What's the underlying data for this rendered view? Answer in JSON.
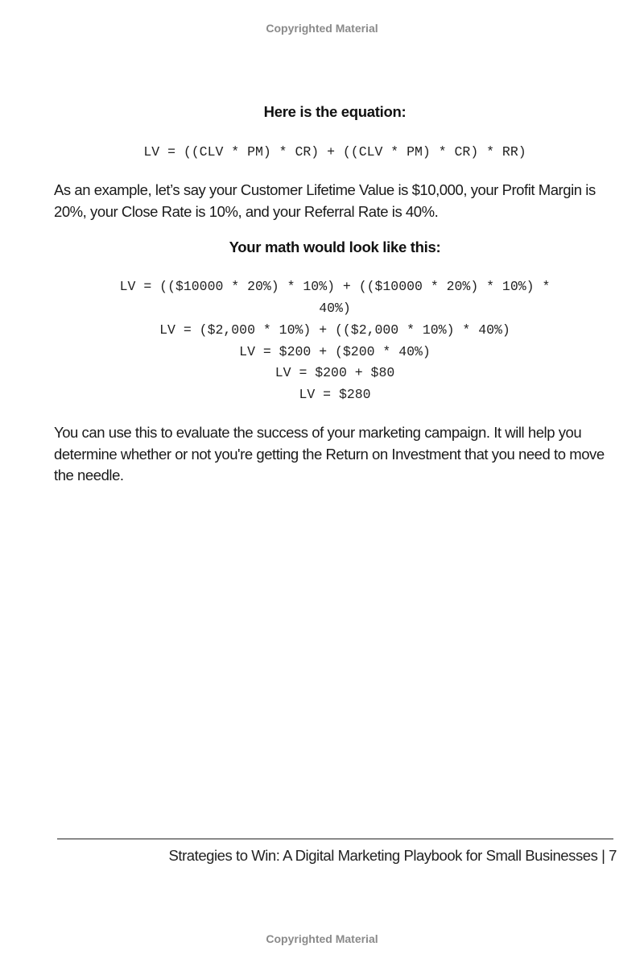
{
  "watermark": {
    "top": "Copyrighted Material",
    "bottom": "Copyrighted Material"
  },
  "content": {
    "equation_heading": "Here is the equation:",
    "equation": "LV = ((CLV * PM) * CR) + ((CLV * PM) * CR) * RR)",
    "example_paragraph": "As an example, let’s say your Customer Lifetime Value is $10,000, your Profit Margin is 20%, your Close Rate is 10%, and your Referral Rate is 40%.",
    "math_heading": "Your math would look like this:",
    "math_lines": [
      "LV = (($10000 * 20%) * 10%) + (($10000 * 20%) * 10%) *",
      "40%)",
      "LV = ($2,000 * 10%) + (($2,000 * 10%) * 40%)",
      "LV = $200 + ($200 * 40%)",
      "LV = $200 + $80",
      "LV = $280"
    ],
    "conclusion_paragraph": "You can use this to evaluate the success of your marketing campaign. It will help you determine whether or not you're getting the Return on Investment that you need to move the needle."
  },
  "footer": {
    "running_title": "Strategies to Win: A Digital Marketing Playbook for Small Businesses",
    "separator": "|",
    "page_number": "7"
  }
}
